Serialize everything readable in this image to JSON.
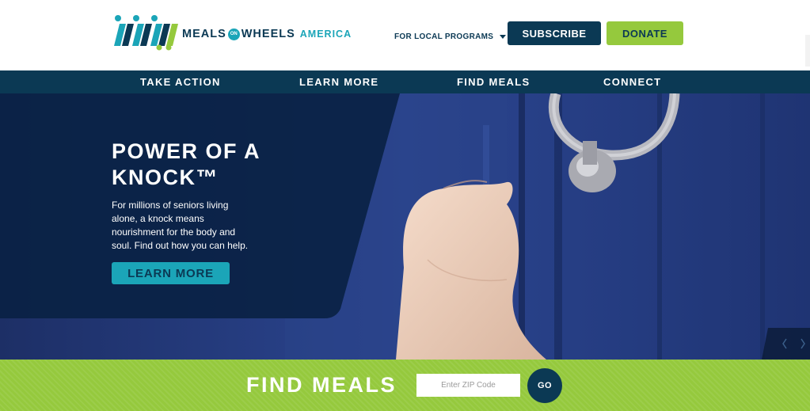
{
  "brand": {
    "logo_meals": "MEALS",
    "logo_on": "ON",
    "logo_wheels": "WHEELS",
    "logo_america": "AMERICA",
    "colors": {
      "navy": "#0b3954",
      "teal": "#1ba5b8",
      "green": "#95c93d"
    }
  },
  "header": {
    "local_programs": "FOR LOCAL PROGRAMS",
    "subscribe": "SUBSCRIBE",
    "donate": "DONATE"
  },
  "nav": {
    "items": [
      {
        "label": "TAKE ACTION"
      },
      {
        "label": "LEARN MORE"
      },
      {
        "label": "FIND MEALS"
      },
      {
        "label": "CONNECT"
      }
    ]
  },
  "hero": {
    "title_line1": "POWER OF A",
    "title_line2": "KNOCK™",
    "body": "For millions of seniors living alone, a knock means nourishment for the body and soul. Find out how you can help.",
    "cta": "LEARN MORE"
  },
  "find_meals": {
    "title": "FIND MEALS",
    "zip_placeholder": "Enter ZIP Code",
    "zip_value": "",
    "go": "GO"
  },
  "icons": [
    "logo-mark-icon",
    "caret-down-icon",
    "prev-arrow-icon",
    "next-arrow-icon"
  ]
}
